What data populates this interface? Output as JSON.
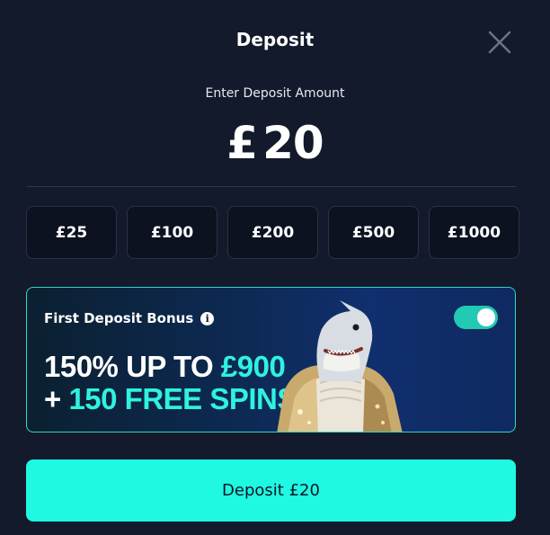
{
  "modal": {
    "title": "Deposit",
    "close_icon": "close-icon"
  },
  "amount": {
    "label": "Enter Deposit Amount",
    "currency": "£",
    "value": "20"
  },
  "presets": [
    "£25",
    "£100",
    "£200",
    "£500",
    "£1000"
  ],
  "bonus": {
    "label": "First Deposit Bonus",
    "info_icon": "info-icon",
    "toggle_on": true,
    "line1_prefix": "150% UP TO ",
    "line1_amount": "£900",
    "line2_prefix": "+ ",
    "line2_rest": "150 FREE SPINS",
    "accent": "#2ff2df",
    "image": "shark-mascot-image"
  },
  "deposit_button": {
    "label": "Deposit £20",
    "color": "#1ff9e2"
  }
}
